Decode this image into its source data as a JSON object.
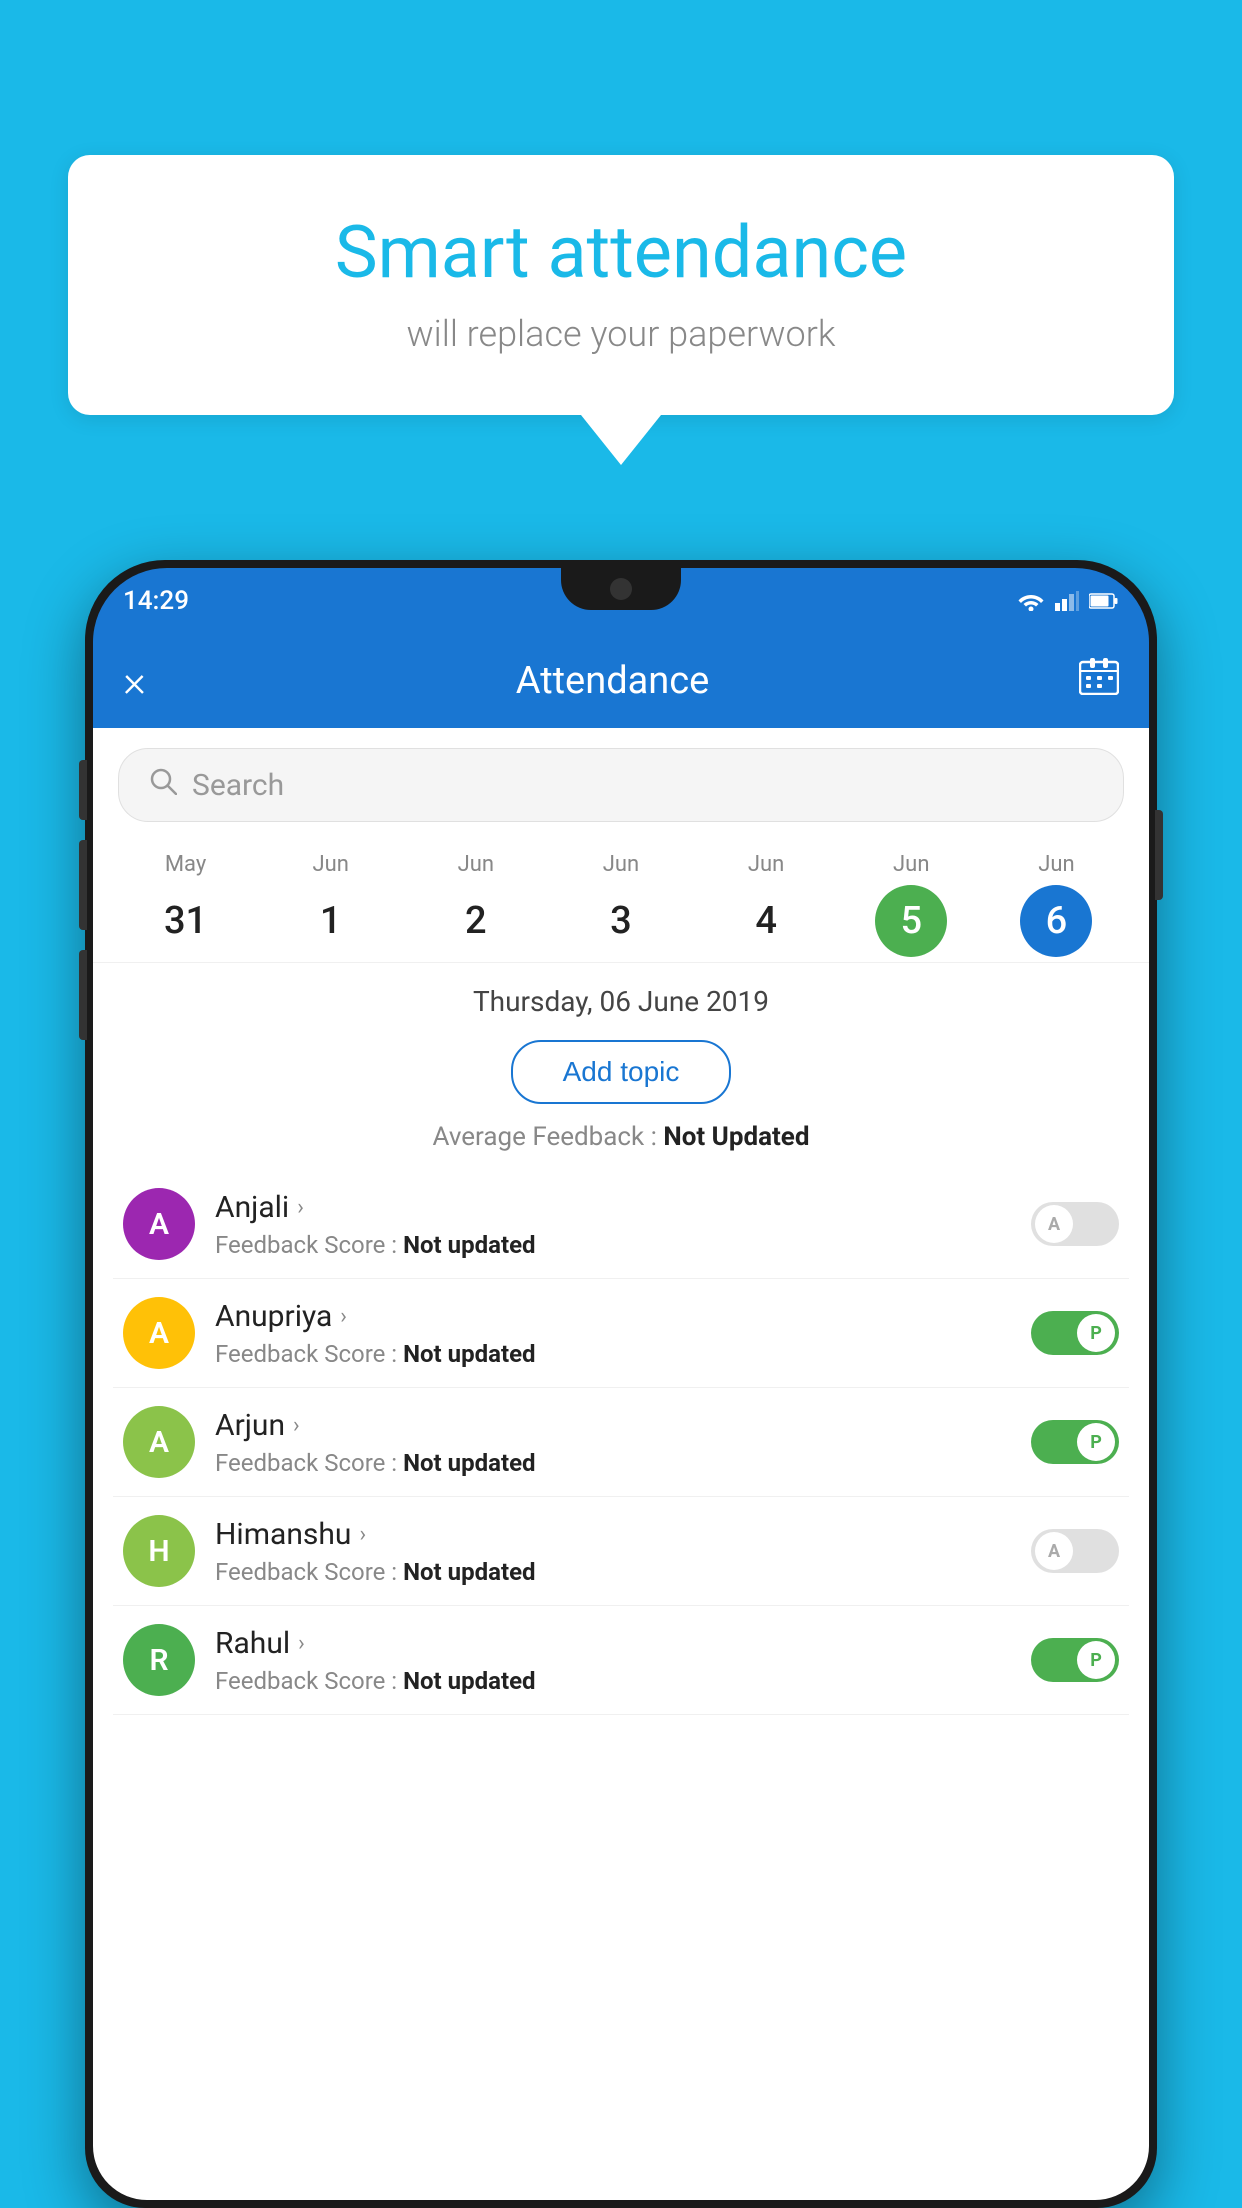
{
  "background_color": "#1ab9e8",
  "bubble": {
    "title": "Smart attendance",
    "subtitle": "will replace your paperwork"
  },
  "status_bar": {
    "time": "14:29",
    "icons": [
      "wifi",
      "signal",
      "battery"
    ]
  },
  "app_bar": {
    "title": "Attendance",
    "close_label": "×",
    "calendar_icon": "📅"
  },
  "search": {
    "placeholder": "Search"
  },
  "calendar": {
    "days": [
      {
        "month": "May",
        "date": "31",
        "state": "normal"
      },
      {
        "month": "Jun",
        "date": "1",
        "state": "normal"
      },
      {
        "month": "Jun",
        "date": "2",
        "state": "normal"
      },
      {
        "month": "Jun",
        "date": "3",
        "state": "normal"
      },
      {
        "month": "Jun",
        "date": "4",
        "state": "normal"
      },
      {
        "month": "Jun",
        "date": "5",
        "state": "today"
      },
      {
        "month": "Jun",
        "date": "6",
        "state": "selected"
      }
    ],
    "selected_date_label": "Thursday, 06 June 2019"
  },
  "add_topic_button": "Add topic",
  "avg_feedback": {
    "label": "Average Feedback : ",
    "value": "Not Updated"
  },
  "students": [
    {
      "name": "Anjali",
      "avatar_letter": "A",
      "avatar_color": "#9c27b0",
      "feedback_label": "Feedback Score : ",
      "feedback_value": "Not updated",
      "attendance": "absent"
    },
    {
      "name": "Anupriya",
      "avatar_letter": "A",
      "avatar_color": "#ffc107",
      "feedback_label": "Feedback Score : ",
      "feedback_value": "Not updated",
      "attendance": "present"
    },
    {
      "name": "Arjun",
      "avatar_letter": "A",
      "avatar_color": "#8bc34a",
      "feedback_label": "Feedback Score : ",
      "feedback_value": "Not updated",
      "attendance": "present"
    },
    {
      "name": "Himanshu",
      "avatar_letter": "H",
      "avatar_color": "#8bc34a",
      "feedback_label": "Feedback Score : ",
      "feedback_value": "Not updated",
      "attendance": "absent"
    },
    {
      "name": "Rahul",
      "avatar_letter": "R",
      "avatar_color": "#4caf50",
      "feedback_label": "Feedback Score : ",
      "feedback_value": "Not updated",
      "attendance": "present"
    }
  ]
}
